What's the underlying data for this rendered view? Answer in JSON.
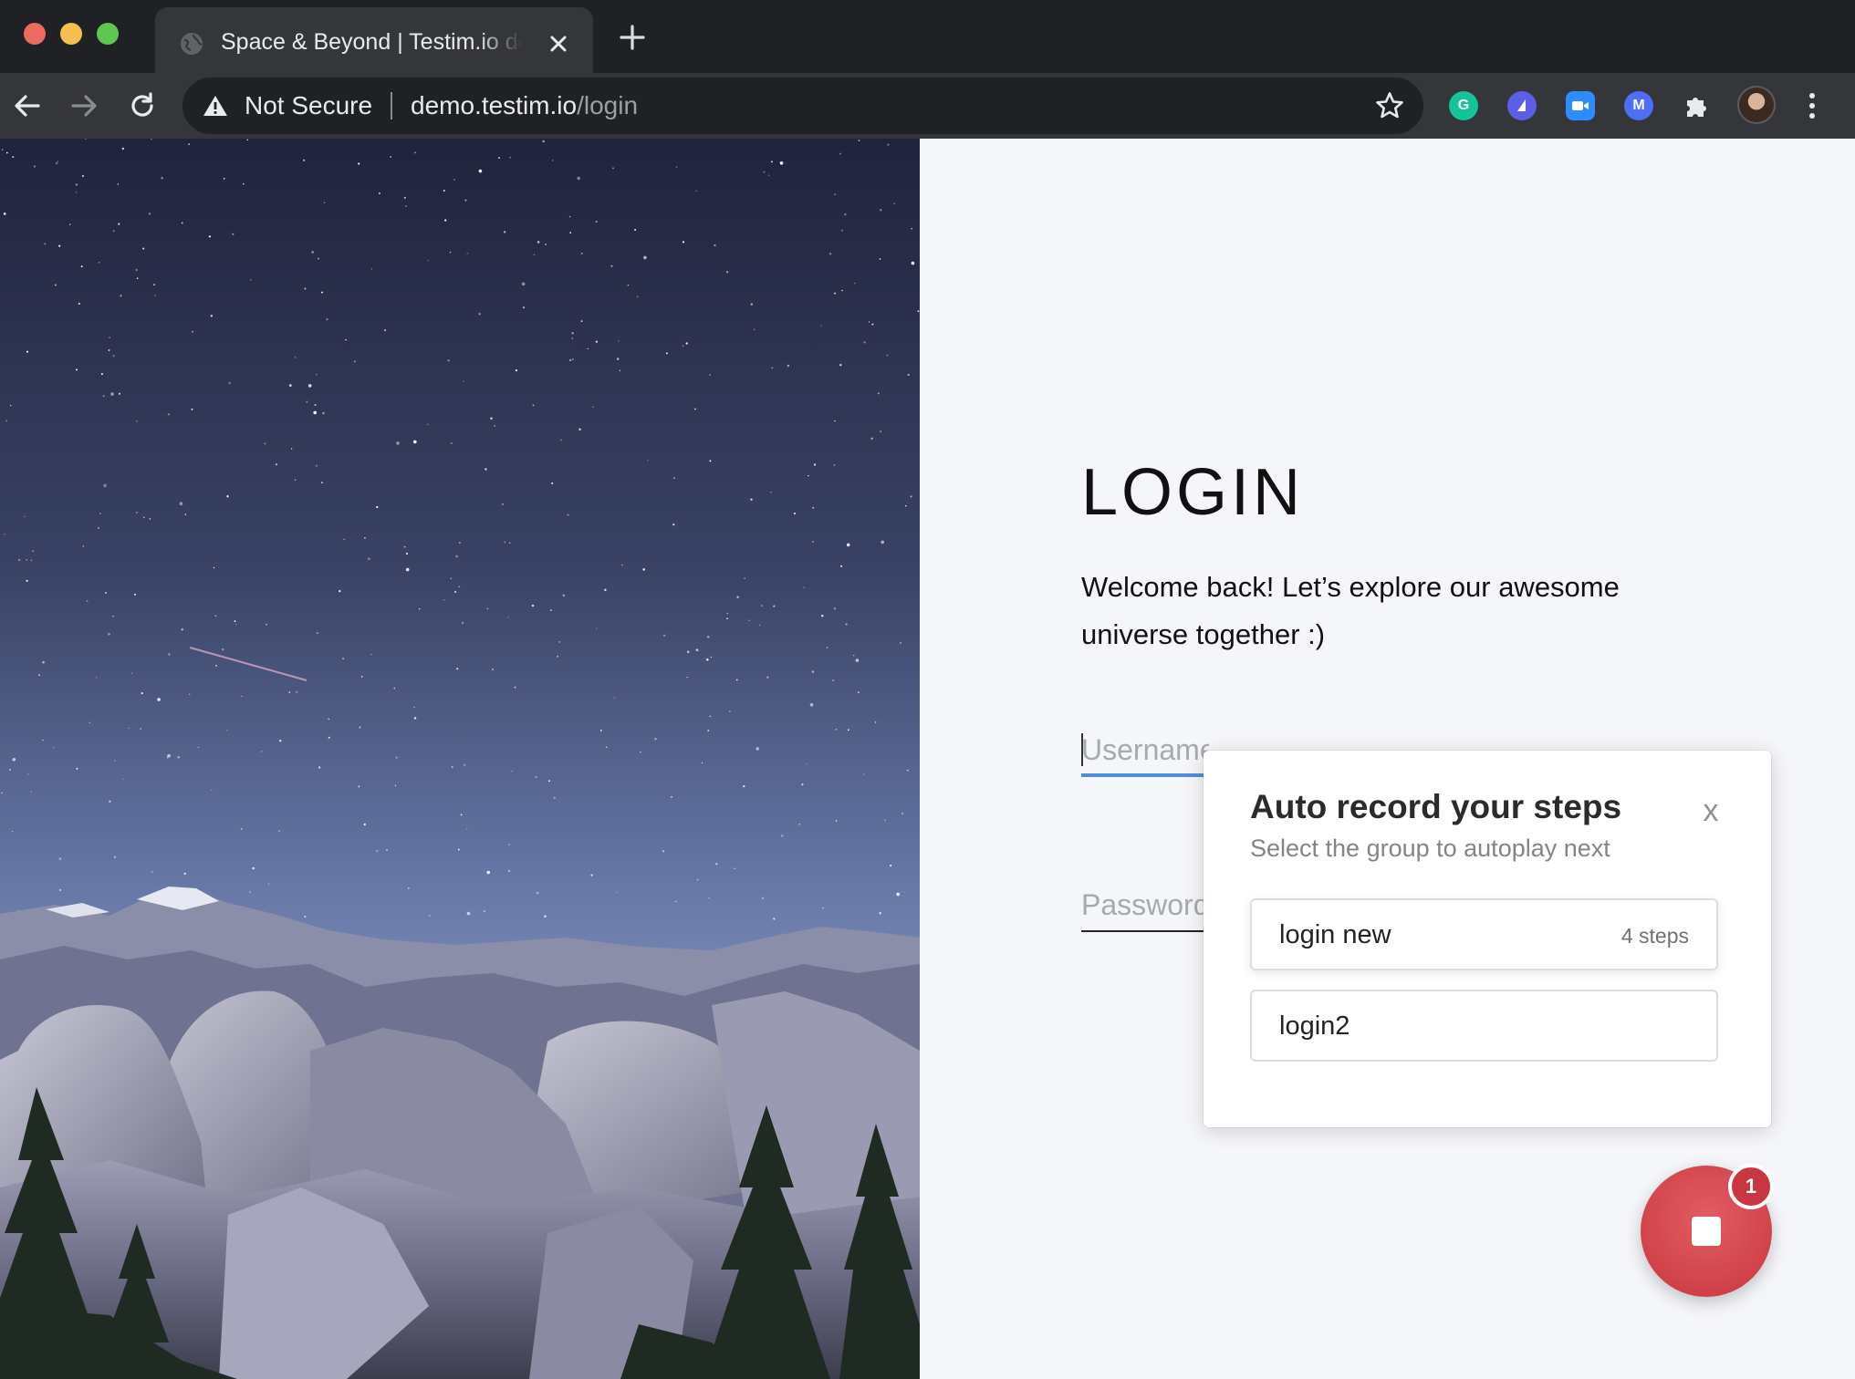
{
  "browser": {
    "tab_title": "Space & Beyond | Testim.io demo",
    "security_label": "Not Secure",
    "url_host": "demo.testim.io",
    "url_path": "/login"
  },
  "page": {
    "title": "LOGIN",
    "welcome_text": "Welcome back! Let’s explore our awesome universe together :)",
    "username_placeholder": "Username",
    "password_placeholder": "Password"
  },
  "popup": {
    "title": "Auto record your steps",
    "subtitle": "Select the group to autoplay next",
    "close_label": "x",
    "groups": [
      {
        "name": "login new",
        "steps": "4 steps"
      },
      {
        "name": "login2",
        "steps": ""
      }
    ]
  },
  "recorder": {
    "badge_count": "1"
  },
  "colors": {
    "accent": "#4a90e2",
    "record_red": "#d9454c",
    "page_bg": "#f5f6fa"
  }
}
